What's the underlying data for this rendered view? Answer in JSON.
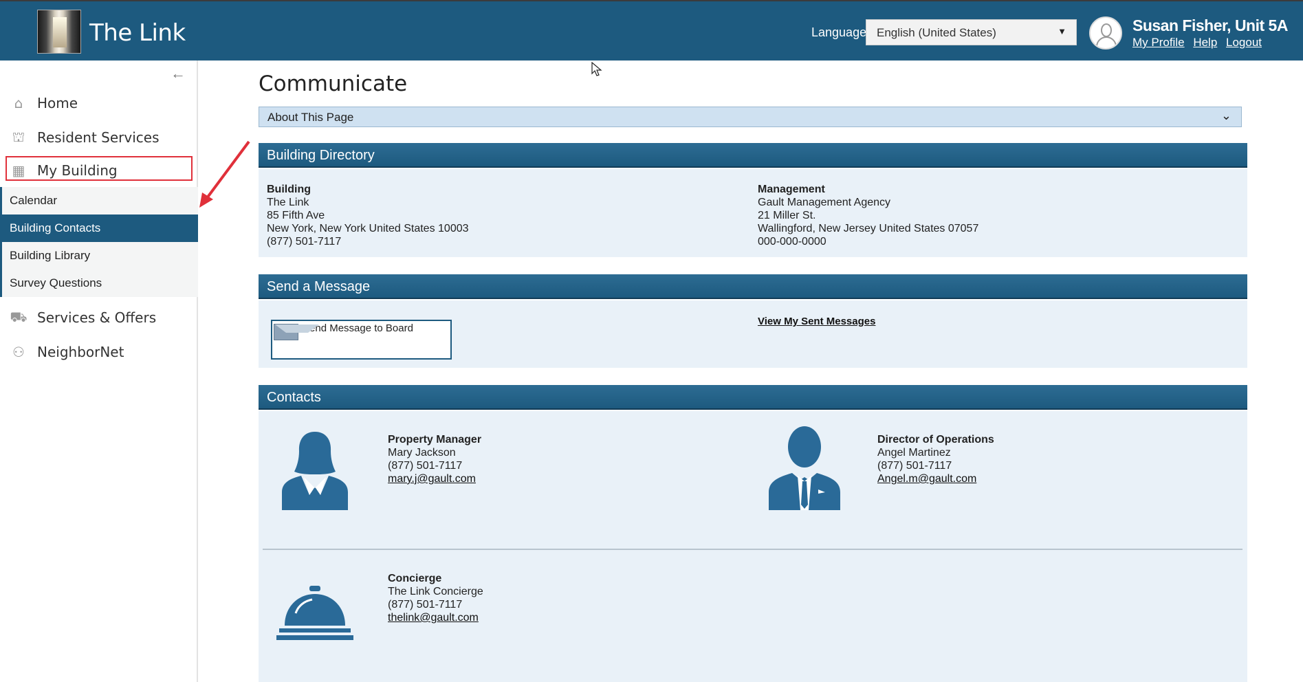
{
  "header": {
    "app_title": "The Link",
    "language_label": "Language:",
    "language_value": "English (United States)",
    "user_name": "Susan Fisher, Unit 5A",
    "links": [
      "My Profile",
      "Help",
      "Logout"
    ]
  },
  "sidebar": {
    "items": [
      {
        "label": "Home",
        "icon": "home-icon"
      },
      {
        "label": "Resident Services",
        "icon": "service-bell-icon"
      },
      {
        "label": "My Building",
        "icon": "building-icon"
      },
      {
        "label": "Services & Offers",
        "icon": "basket-icon"
      },
      {
        "label": "NeighborNet",
        "icon": "people-icon"
      }
    ],
    "sub_items": [
      "Calendar",
      "Building Contacts",
      "Building Library",
      "Survey Questions"
    ],
    "active_sub_item": "Building Contacts"
  },
  "main": {
    "page_title": "Communicate",
    "about_label": "About This Page",
    "directory": {
      "title": "Building Directory",
      "building": {
        "heading": "Building",
        "name": "The Link",
        "street": "85 Fifth Ave",
        "city": "New York, New York United States 10003",
        "phone": "(877) 501-7117"
      },
      "management": {
        "heading": "Management",
        "name": "Gault Management Agency",
        "street": "21 Miller St.",
        "city": "Wallingford, New Jersey United States 07057",
        "phone": "000-000-0000"
      }
    },
    "message": {
      "title": "Send a Message",
      "button_label": "Send Message to Board",
      "sent_link": "View My Sent Messages"
    },
    "contacts": {
      "title": "Contacts",
      "list": [
        {
          "role": "Property Manager",
          "name": "Mary Jackson",
          "phone": "(877) 501-7117",
          "email": "mary.j@gault.com",
          "icon": "female-person-icon"
        },
        {
          "role": "Director of Operations",
          "name": "Angel Martinez",
          "phone": "(877) 501-7117",
          "email": "Angel.m@gault.com",
          "icon": "male-person-icon"
        },
        {
          "role": "Concierge",
          "name": "The Link Concierge",
          "phone": "(877) 501-7117",
          "email": "thelink@gault.com",
          "icon": "concierge-bell-icon"
        }
      ]
    }
  },
  "colors": {
    "brand": "#1d5a7f",
    "panel_bg": "#e9f1f8",
    "highlight": "#e0303a"
  }
}
